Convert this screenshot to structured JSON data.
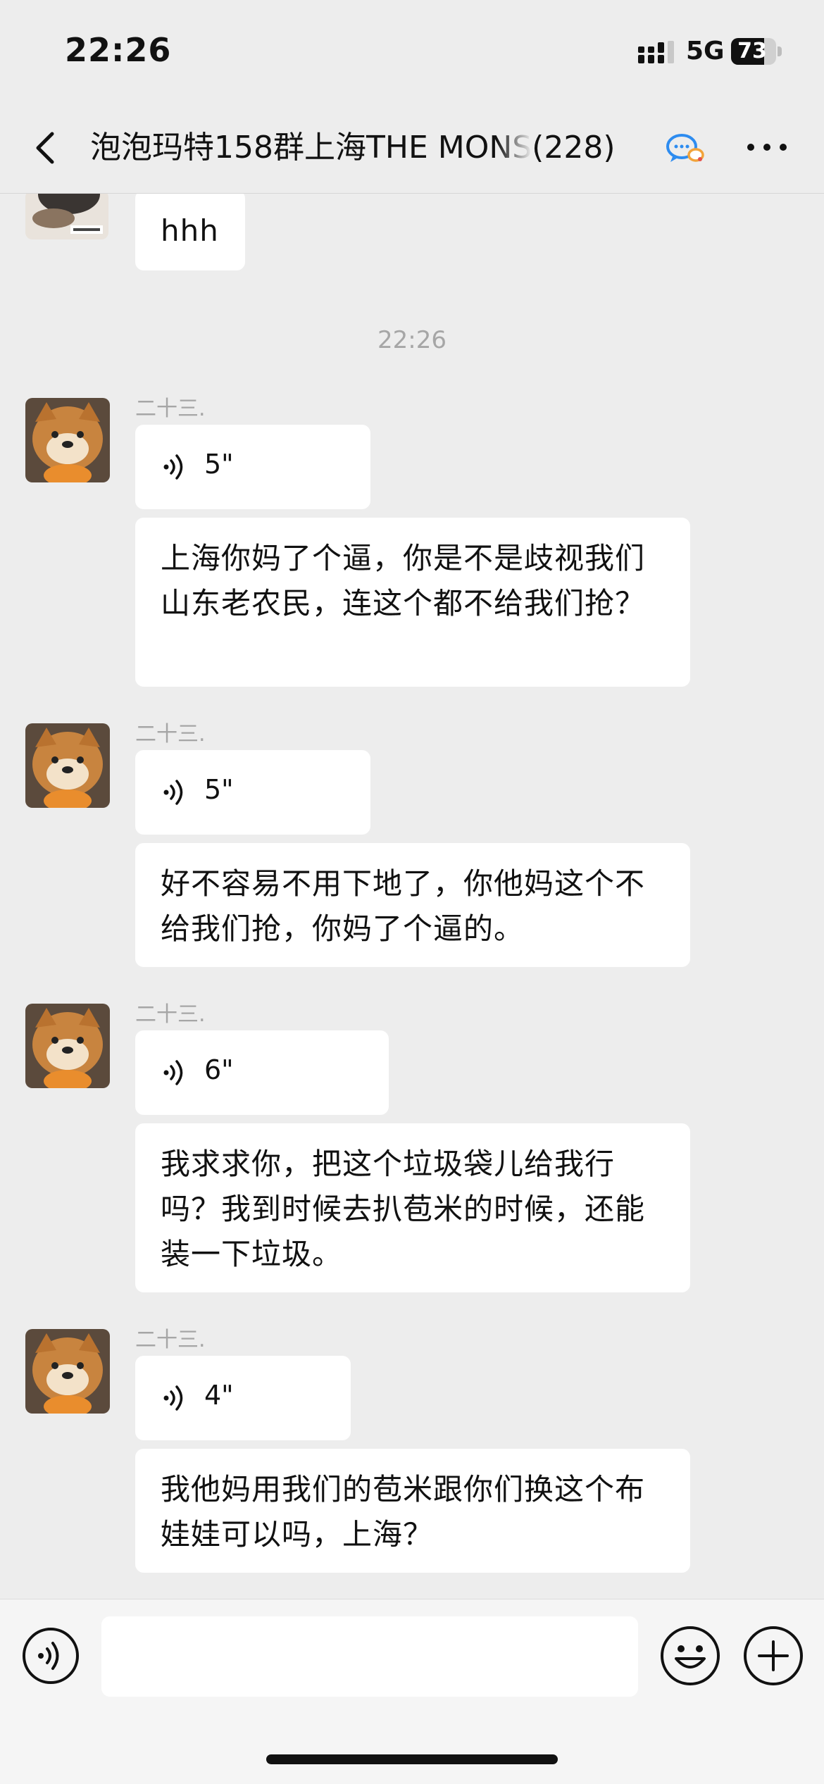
{
  "status_bar": {
    "time": "22:26",
    "network": "5G",
    "battery_level": "73",
    "battery_fraction": 0.73
  },
  "nav": {
    "title": "泡泡玛特158群上海THE MONS",
    "member_count": "(228)",
    "icons": {
      "back": "chevron-left-icon",
      "chat": "chat-bubbles-icon",
      "more": "more-icon"
    }
  },
  "messages": {
    "first": {
      "text": "hhh"
    },
    "time_separator": "22:26",
    "groups": [
      {
        "sender": "二十三.",
        "voice_duration": "5\"",
        "text": "上海你妈了个逼，你是不是歧视我们山东老农民，连这个都不给我们抢？"
      },
      {
        "sender": "二十三.",
        "voice_duration": "5\"",
        "text": "好不容易不用下地了，你他妈这个不给我们抢，你妈了个逼的。"
      },
      {
        "sender": "二十三.",
        "voice_duration": "6\"",
        "text": "我求求你，把这个垃圾袋儿给我行吗？我到时候去扒苞米的时候，还能装一下垃圾。"
      },
      {
        "sender": "二十三.",
        "voice_duration": "4\"",
        "text": "我他妈用我们的苞米跟你们换这个布娃娃可以吗，上海？"
      }
    ]
  },
  "input_bar": {
    "value": "",
    "icons": {
      "voice": "voice-input-icon",
      "emoji": "emoji-icon",
      "plus": "plus-icon"
    }
  }
}
